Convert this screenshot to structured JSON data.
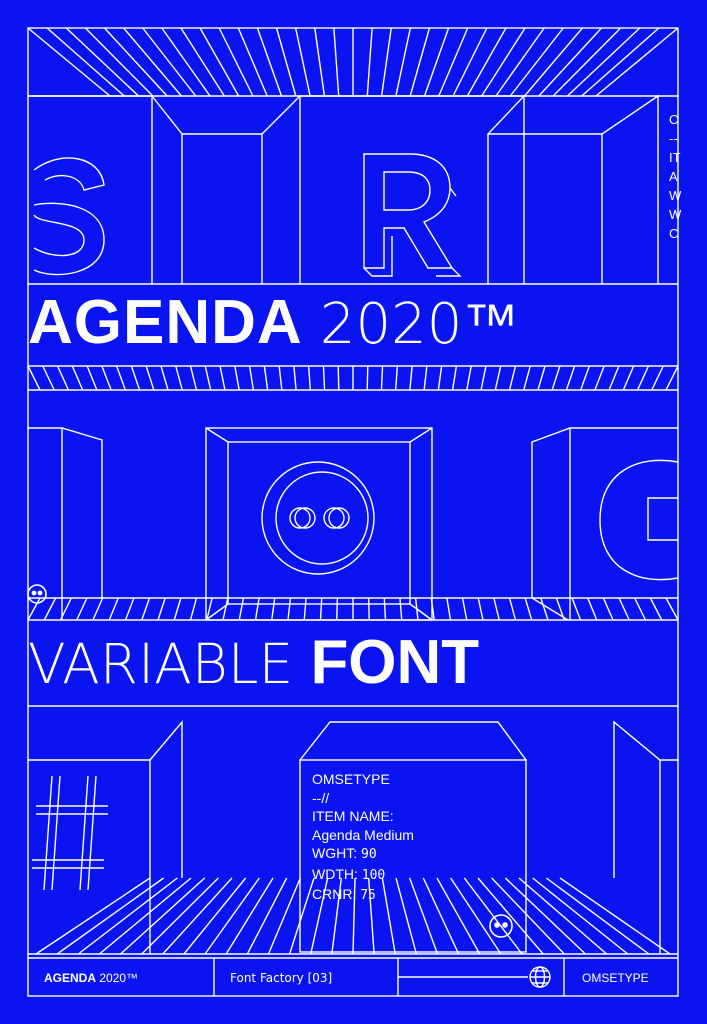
{
  "headline": {
    "bold": "AGENDA",
    "light": "2020™"
  },
  "subheadline": {
    "light": "VARIABLE",
    "bold": "FONT"
  },
  "item_card": {
    "line1": "OMSETYPE",
    "line2": "--//",
    "line3": "ITEM NAME:",
    "line4": "Agenda Medium",
    "wght_label": "WGHT:",
    "wght_value": "90",
    "wdth_label": "WDTH:",
    "wdth_value": "100",
    "crnr_label": "CRNR:",
    "crnr_value": "75"
  },
  "side_text": [
    "O",
    "--",
    "IT",
    "A",
    "W",
    "W",
    "C"
  ],
  "footer": {
    "brand_bold": "AGENDA",
    "brand_light": "2020™",
    "series": "Font Factory [03]",
    "publisher": "OMSETYPE"
  },
  "colors": {
    "background": "#0a14f0",
    "line": "#ffffff"
  },
  "icons": [
    "smiley-face-icon",
    "globe-icon"
  ]
}
